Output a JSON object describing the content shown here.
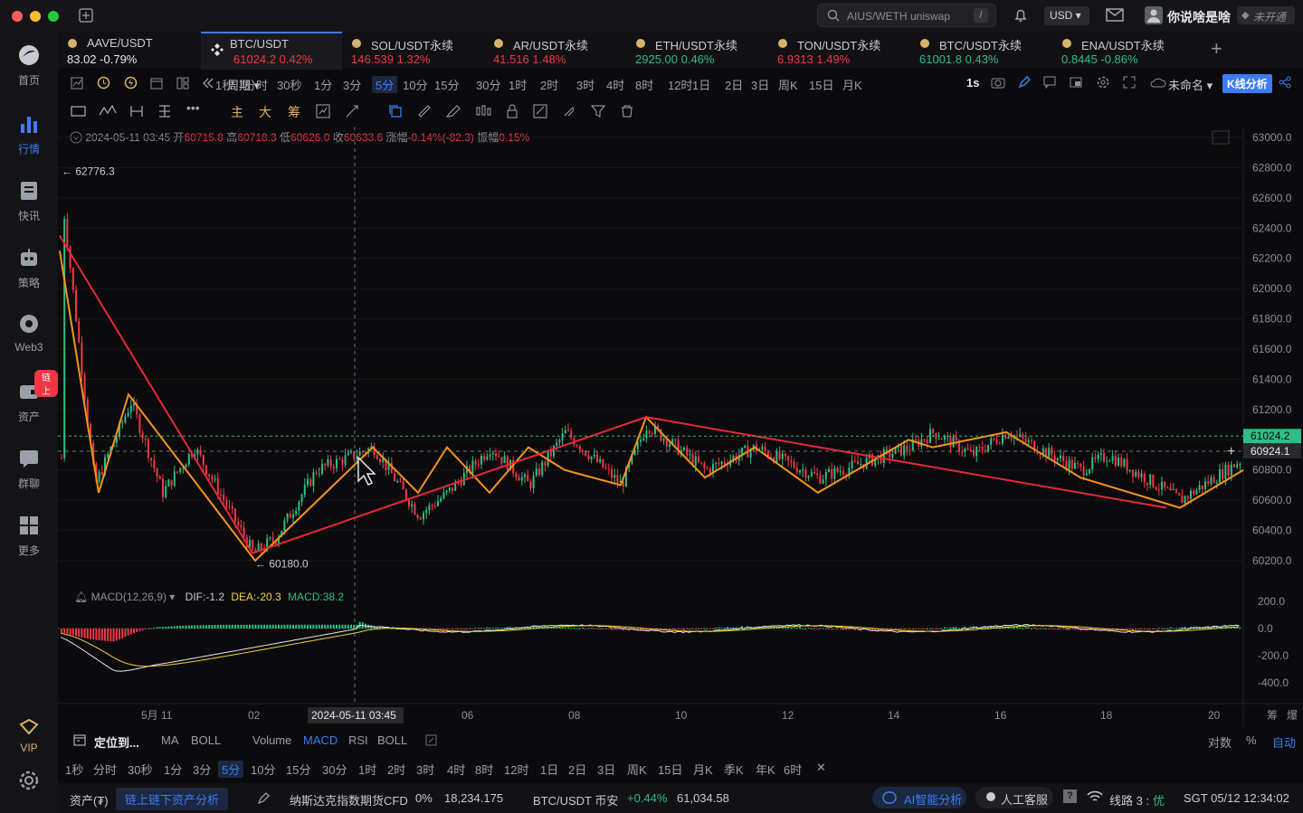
{
  "titlebar": {
    "search_placeholder": "AIUS/WETH uniswap",
    "search_shortcut": "/",
    "currency": "USD",
    "username": "你说啥是啥",
    "account_status": "未开通"
  },
  "sidebar": {
    "items": [
      {
        "label": "首页",
        "icon": "home-icon"
      },
      {
        "label": "行情",
        "icon": "market-icon"
      },
      {
        "label": "快讯",
        "icon": "news-icon"
      },
      {
        "label": "策略",
        "icon": "strategy-icon"
      },
      {
        "label": "Web3",
        "icon": "web3-icon"
      },
      {
        "label": "资产",
        "icon": "wallet-icon",
        "badge": "链上"
      },
      {
        "label": "群聊",
        "icon": "chat-icon"
      },
      {
        "label": "更多",
        "icon": "more-icon"
      }
    ],
    "vip_label": "VIP"
  },
  "tabs": [
    {
      "name": "AAVE/USDT",
      "price": "83.02",
      "change": "-0.79%",
      "color": "#e6e8ea"
    },
    {
      "name": "BTC/USDT",
      "price": "61024.2",
      "change": "0.42%",
      "color": "#f23645",
      "active": true
    },
    {
      "name": "SOL/USDT永续",
      "price": "146.539",
      "change": "1.32%",
      "color": "#f23645"
    },
    {
      "name": "AR/USDT永续",
      "price": "41.516",
      "change": "1.48%",
      "color": "#f23645"
    },
    {
      "name": "ETH/USDT永续",
      "price": "2925.00",
      "change": "0.46%",
      "color": "#2ebd85"
    },
    {
      "name": "TON/USDT永续",
      "price": "6.9313",
      "change": "1.49%",
      "color": "#f23645"
    },
    {
      "name": "BTC/USDT永续",
      "price": "61001.8",
      "change": "0.43%",
      "color": "#2ebd85"
    },
    {
      "name": "ENA/USDT永续",
      "price": "0.8445",
      "change": "-0.86%",
      "color": "#2ebd85"
    }
  ],
  "periodbar": {
    "label": "周期",
    "periods": [
      "1秒",
      "分时",
      "30秒",
      "1分",
      "3分",
      "5分",
      "10分",
      "15分",
      "30分",
      "1时",
      "2时",
      "3时",
      "4时",
      "8时",
      "12时",
      "1日",
      "2日",
      "3日",
      "周K",
      "15日",
      "月K"
    ],
    "active": "5分",
    "interval": "1s",
    "layout_name": "未命名",
    "analysis_button": "K线分析"
  },
  "drawbar": {
    "labels": [
      "主",
      "大",
      "筹"
    ]
  },
  "ohlc": {
    "time": "2024-05-11 03:45",
    "open_label": "开",
    "open": "60715.8",
    "high_label": "高",
    "high": "60718.3",
    "low_label": "低",
    "low": "60626.0",
    "close_label": "收",
    "close": "60633.6",
    "chg_label": "涨幅",
    "chg": "-0.14%(-82.3)",
    "amp_label": "振幅",
    "amp": "0.15%"
  },
  "price_axis": [
    "63000.0",
    "62800.0",
    "62600.0",
    "62400.0",
    "62200.0",
    "62000.0",
    "61800.0",
    "61600.0",
    "61400.0",
    "61200.0",
    "61000.0",
    "60800.0",
    "60600.0",
    "60400.0",
    "60200.0"
  ],
  "price_tags": {
    "last": "61024.2",
    "cursor": "60924.1",
    "max": "62776.3",
    "min": "60180.0"
  },
  "macd": {
    "label": "MACD(12,26,9)",
    "dif": "DIF:-1.2",
    "dea": "DEA:-20.3",
    "macd": "MACD:38.2",
    "axis": [
      "200.0",
      "0.0",
      "-200.0",
      "-400.0"
    ]
  },
  "time_axis": [
    "5月 11",
    "02",
    "06",
    "08",
    "10",
    "12",
    "14",
    "16",
    "18",
    "20"
  ],
  "cursor_time": "2024-05-11 03:45",
  "axis_corner": [
    "筹",
    "爆"
  ],
  "indbar": {
    "locate": "定位到...",
    "main": [
      "MA",
      "BOLL"
    ],
    "sub": [
      "Volume",
      "MACD",
      "RSI",
      "BOLL"
    ],
    "active": "MACD",
    "right": [
      "对数",
      "%",
      "自动"
    ]
  },
  "periodbar2": {
    "periods": [
      "1秒",
      "分时",
      "30秒",
      "1分",
      "3分",
      "5分",
      "10分",
      "15分",
      "30分",
      "1时",
      "2时",
      "3时",
      "4时",
      "8时",
      "12时",
      "1日",
      "2日",
      "3日",
      "周K",
      "15日",
      "月K",
      "季K",
      "年K",
      "6时"
    ],
    "active": "5分"
  },
  "statusbar": {
    "asset": "资产(₮)",
    "analysis_link": "链上链下资产分析",
    "ticker1_name": "纳斯达克指数期货CFD",
    "ticker1_change": "0%",
    "ticker1_price": "18,234.175",
    "ticker2_name": "BTC/USDT 币安",
    "ticker2_change": "+0.44%",
    "ticker2_price": "61,034.58",
    "ai_button": "AI智能分析",
    "support_button": "人工客服",
    "line_label": "线路 3 :",
    "line_status": "优",
    "clock": "SGT 05/12 12:34:02"
  },
  "colors": {
    "up": "#2ebd85",
    "down": "#f23645",
    "accent": "#3c7cf5",
    "zz1": "#f7931a",
    "zz2": "#e8273a"
  }
}
